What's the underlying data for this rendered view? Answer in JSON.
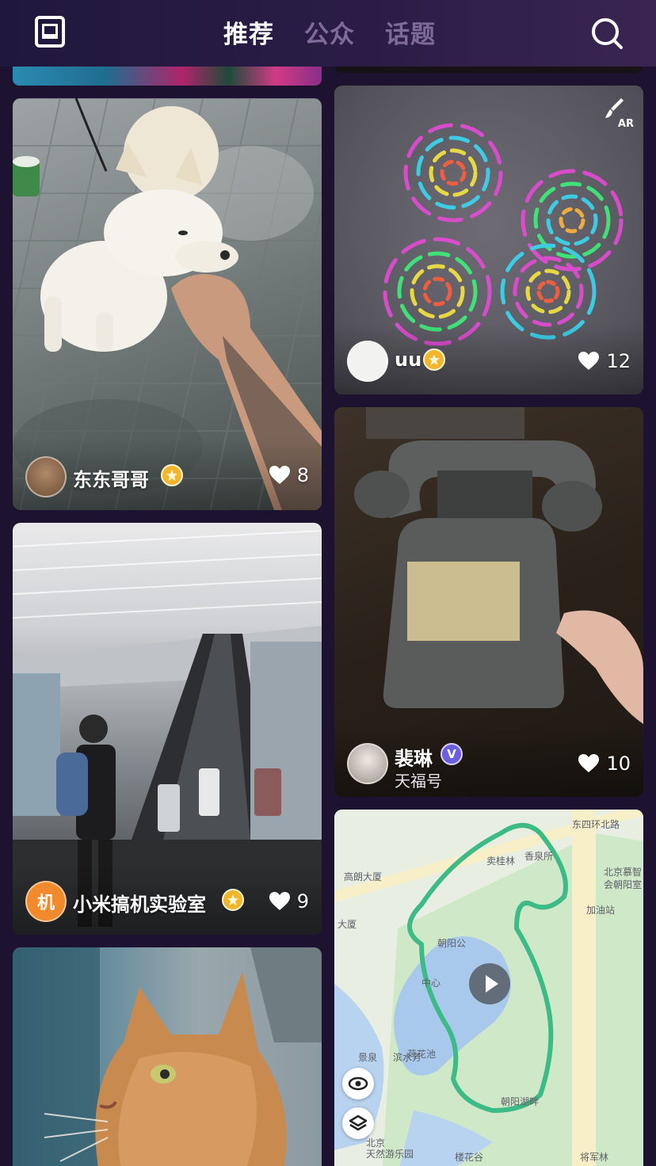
{
  "header": {
    "tabs": [
      {
        "label": "推荐",
        "active": true
      },
      {
        "label": "公众",
        "active": false
      },
      {
        "label": "话题",
        "active": false
      }
    ],
    "menu_icon": "menu-icon",
    "search_icon": "search-icon"
  },
  "feed": {
    "posts": [
      {
        "user": "东东哥哥",
        "badge": "gold",
        "likes": "8",
        "photo": "shiba-dog-photo"
      },
      {
        "user": "uu",
        "badge": "gold",
        "likes": "12",
        "photo": "ar-light-drawing",
        "ar_label": "AR"
      },
      {
        "user": "裴琳",
        "badge": "verified",
        "badge_text": "V",
        "subline": "天福号",
        "likes": "10",
        "photo": "vintage-telephone-photo"
      },
      {
        "user": "小米搞机实验室",
        "badge": "gold",
        "likes": "9",
        "avatar_text": "机",
        "photo": "station-escalator-photo"
      },
      {
        "user": "",
        "photo": "cat-photo"
      },
      {
        "photo": "running-route-map",
        "map_labels": [
          "东四环北路",
          "高朗大厦",
          "北京慕智",
          "会朝阳室",
          "加油站",
          "卖桂林",
          "香泉所",
          "大厦",
          "朝阳公",
          "荷花池",
          "景泉",
          "滨水芳",
          "北京",
          "朝阳湖畔",
          "天然游乐园",
          "楼花谷",
          "将军林",
          "中心"
        ]
      }
    ]
  },
  "colors": {
    "background": "#1d1330",
    "tab_active": "#ffffff",
    "tab_inactive": "#7e6b99",
    "badge_gold": "#f3b52a",
    "badge_verified": "#6b5fe0",
    "route_green": "#3dbb86"
  }
}
